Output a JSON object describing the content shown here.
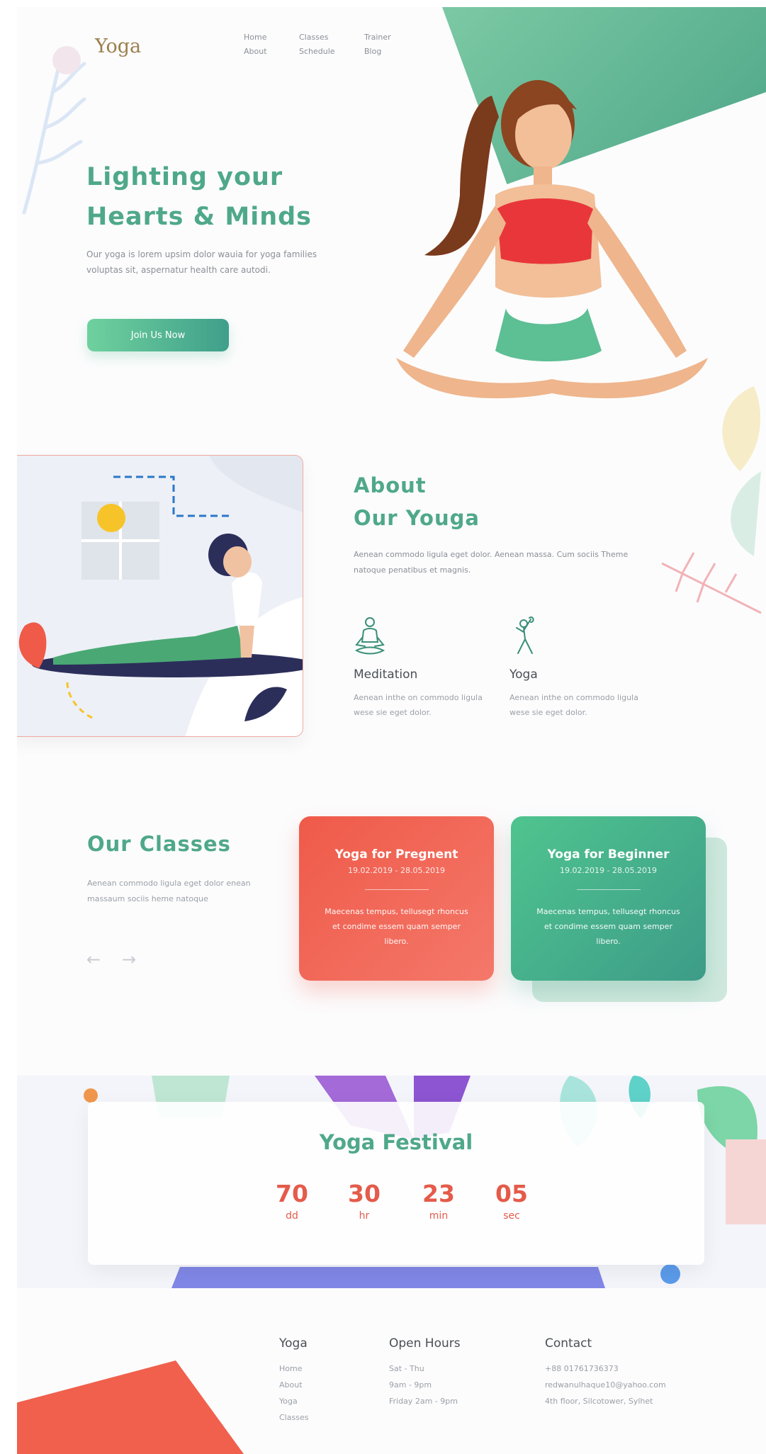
{
  "brand": {
    "logo": "Yoga"
  },
  "nav": {
    "items": [
      "Home",
      "Classes",
      "Trainer",
      "About",
      "Schedule",
      "Blog"
    ]
  },
  "hero": {
    "title_line1": "Lighting your",
    "title_line2": "Hearts & Minds",
    "description": "Our yoga is lorem upsim dolor wauia for yoga families voluptas sit, aspernatur health care autodi.",
    "cta": "Join Us Now"
  },
  "about": {
    "title_line1": "About",
    "title_line2": "Our Youga",
    "description": "Aenean commodo ligula eget dolor. Aenean massa. Cum sociis Theme natoque penatibus et magnis.",
    "features": [
      {
        "icon": "meditation-icon",
        "title": "Meditation",
        "text": "Aenean inthe on commodo ligula wese sie eget dolor."
      },
      {
        "icon": "yoga-pose-icon",
        "title": "Yoga",
        "text": "Aenean inthe on commodo ligula wese sie eget dolor."
      }
    ]
  },
  "classes": {
    "title": "Our Classes",
    "description": "Aenean commodo ligula eget dolor enean massaum sociis heme natoque",
    "prev_icon": "arrow-left-icon",
    "next_icon": "arrow-right-icon",
    "cards": [
      {
        "title": "Yoga for Pregnent",
        "dates": "19.02.2019 - 28.05.2019",
        "text": "Maecenas tempus, tellusegt rhoncus et condime essem quam semper libero.",
        "color": "#ef5a49"
      },
      {
        "title": "Yoga for Beginner",
        "dates": "19.02.2019 - 28.05.2019",
        "text": "Maecenas tempus, tellusegt rhoncus et condime essem quam semper libero.",
        "color": "#4bbf8c"
      }
    ]
  },
  "festival": {
    "title": "Yoga Festival",
    "countdown": [
      {
        "value": "70",
        "label": "dd"
      },
      {
        "value": "30",
        "label": "hr"
      },
      {
        "value": "23",
        "label": "min"
      },
      {
        "value": "05",
        "label": "sec"
      }
    ]
  },
  "footer": {
    "columns": [
      {
        "title": "Yoga",
        "items": [
          "Home",
          "About",
          "Yoga",
          "Classes"
        ]
      },
      {
        "title": "Open Hours",
        "items": [
          "Sat - Thu",
          "9am - 9pm",
          "Friday 2am - 9pm"
        ]
      },
      {
        "title": "Contact",
        "items": [
          "+88 01761736373",
          "redwanulhaque10@yahoo.com",
          "4th floor, Silcotower, Sylhet"
        ]
      }
    ]
  },
  "colors": {
    "accent": "#4fa88a",
    "coral": "#ef5a49",
    "green": "#4bbf8c"
  }
}
